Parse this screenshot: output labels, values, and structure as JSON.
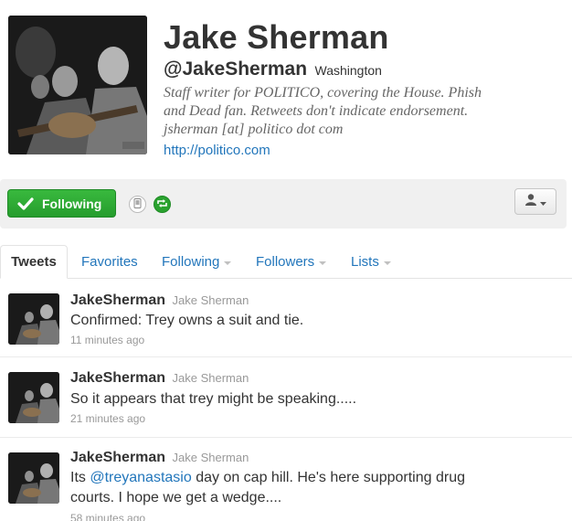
{
  "profile": {
    "name": "Jake Sherman",
    "handle": "@JakeSherman",
    "location": "Washington",
    "bio_lines": [
      "Staff writer for POLITICO, covering the House. Phish",
      "and Dead fan. Retweets don't indicate endorsement.",
      "jsherman [at] politico dot com"
    ],
    "url": "http://politico.com"
  },
  "actions": {
    "following_label": "Following",
    "device_icon": "device-icon",
    "retweet_icon": "retweet-icon",
    "user_menu_icon": "user-icon",
    "accent_green": "#2aa22f"
  },
  "tabs": [
    {
      "label": "Tweets",
      "active": true
    },
    {
      "label": "Favorites"
    },
    {
      "label": "Following",
      "has_menu": true
    },
    {
      "label": "Followers",
      "has_menu": true
    },
    {
      "label": "Lists",
      "has_menu": true
    }
  ],
  "tweets": [
    {
      "username": "JakeSherman",
      "fullname": "Jake Sherman",
      "text": "Confirmed: Trey owns a suit and tie.",
      "time": "11 minutes ago"
    },
    {
      "username": "JakeSherman",
      "fullname": "Jake Sherman",
      "text": "So it appears that trey might be speaking.....",
      "time": "21 minutes ago"
    },
    {
      "username": "JakeSherman",
      "fullname": "Jake Sherman",
      "text_before": "Its ",
      "mention": "@treyanastasio",
      "text_after_line1": " day on cap hill. He's here supporting drug",
      "text_line2": "courts. I hope we get a wedge....",
      "time": "58 minutes ago"
    }
  ],
  "colors": {
    "link": "#2276bb",
    "text": "#333333",
    "muted": "#999999"
  }
}
